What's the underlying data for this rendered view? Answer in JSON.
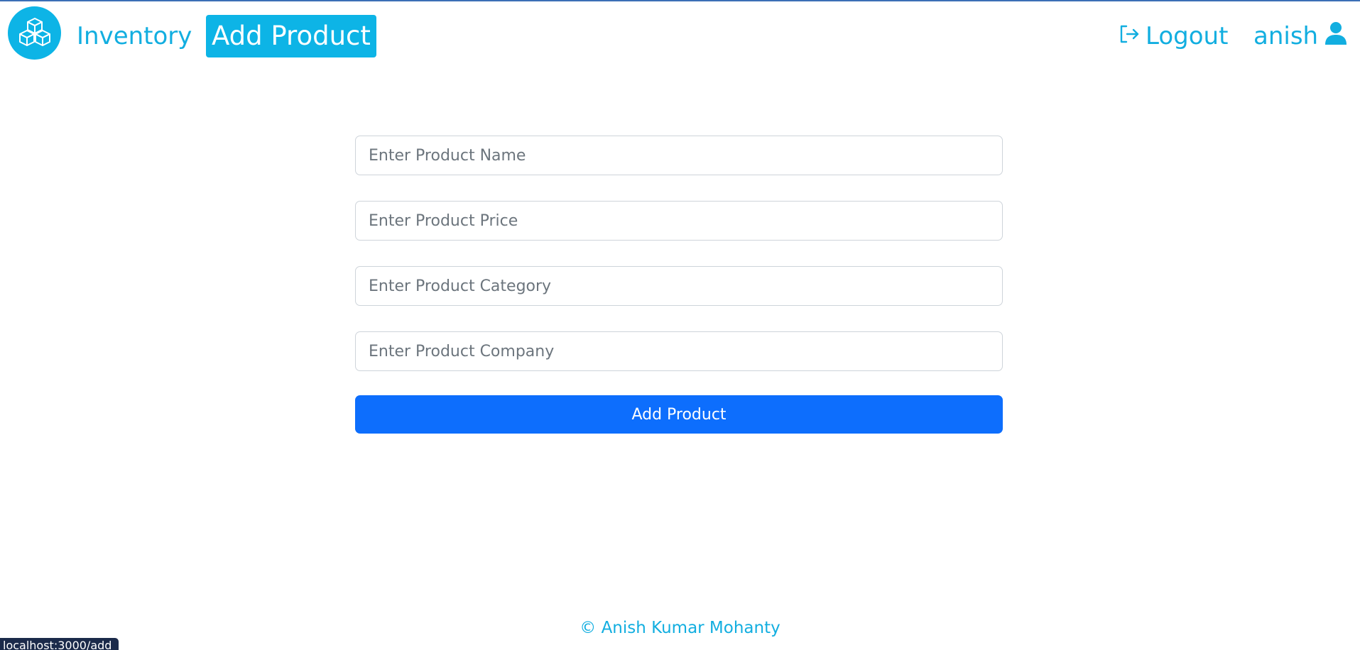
{
  "nav": {
    "logo_icon": "boxes-icon",
    "inventory_label": "Inventory",
    "add_product_label": "Add Product",
    "logout_label": "Logout",
    "logout_icon": "logout-icon",
    "username": "anish",
    "user_icon": "user-icon"
  },
  "form": {
    "name_placeholder": "Enter Product Name",
    "price_placeholder": "Enter Product Price",
    "category_placeholder": "Enter Product Category",
    "company_placeholder": "Enter Product Company",
    "submit_label": "Add Product"
  },
  "footer": {
    "text": "© Anish Kumar Mohanty"
  },
  "status_bar": {
    "url": "localhost:3000/add"
  },
  "colors": {
    "accent": "#0db4e6",
    "link": "#12aee0",
    "primary_button": "#0d6efd",
    "top_line": "#3b6fb6"
  }
}
